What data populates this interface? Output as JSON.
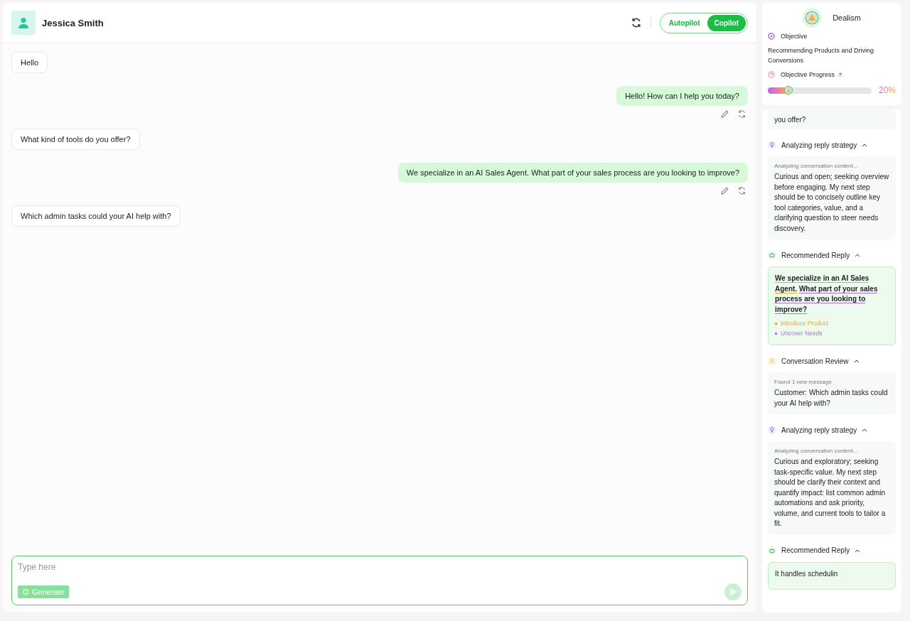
{
  "contact": {
    "name": "Jessica Smith"
  },
  "mode_toggle": [
    {
      "label": "Autopilot",
      "selected": false
    },
    {
      "label": "Copilot",
      "selected": true
    }
  ],
  "messages": [
    {
      "kind": "customer",
      "text": "Hello"
    },
    {
      "kind": "agent",
      "text": "Hello! How can I help you today?"
    },
    {
      "kind": "customer",
      "text": "What kind of tools do you offer?"
    },
    {
      "kind": "agent",
      "text": "We specialize in an AI Sales Agent. What part of your sales process are you looking to improve?"
    },
    {
      "kind": "customer",
      "text": "Which admin tasks could your AI help with?"
    }
  ],
  "composer": {
    "placeholder": "Type here",
    "generate_label": "Generate"
  },
  "agent_card": {
    "name": "Dealism",
    "objective_label": "Objective",
    "objective": "Recommending Products and Driving Conversions",
    "progress_label": "Objective Progress",
    "help": "?",
    "level": 0.2,
    "reading": "20%"
  },
  "feed": [
    {
      "kind": "fragment",
      "body": "you offer?"
    },
    {
      "kind": "strategy",
      "title": "Analyzing reply strategy",
      "status": "Analyzing conversation content...",
      "body": "Curious and open; seeking overview before engaging. My next step should be to concisely outline key tool categories, value, and a clarifying question to steer needs discovery."
    },
    {
      "kind": "reply",
      "title": "Recommended Reply",
      "segments": [
        {
          "text": "We specialize in an AI Sales Agent.",
          "color": "#f5a623"
        },
        {
          "text": "What part of your sales process are you looking to improve?",
          "color": "#b26be0"
        }
      ],
      "tags": [
        {
          "label": "Introduce Product",
          "color": "#f5a623"
        },
        {
          "label": "Uncover Needs",
          "color": "#b26be0"
        }
      ]
    },
    {
      "kind": "review",
      "title": "Conversation Review",
      "status": "Found 1 new message",
      "body": "Customer: Which admin tasks could your AI help with?"
    },
    {
      "kind": "strategy",
      "title": "Analyzing reply strategy",
      "status": "Analyzing conversation content...",
      "body": "Curious and exploratory; seeking task-specific value. My next step should be clarify their context and quantify impact: list common admin automations and ask priority, volume, and current tools to tailor a fit."
    },
    {
      "kind": "reply",
      "title": "Recommended Reply",
      "segments": [
        {
          "text": "It handles schedulin"
        }
      ]
    }
  ]
}
